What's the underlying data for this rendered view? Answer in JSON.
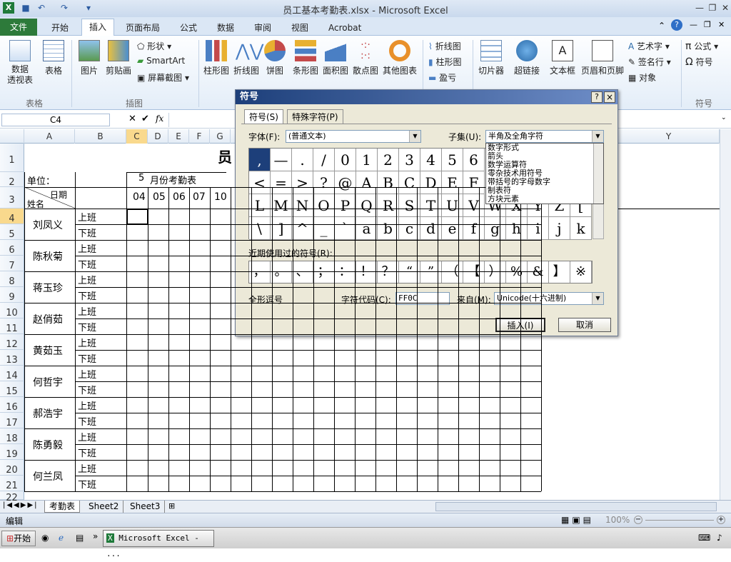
{
  "window": {
    "title": "员工基本考勤表.xlsx  -  Microsoft Excel"
  },
  "tabs": [
    "文件",
    "开始",
    "插入",
    "页面布局",
    "公式",
    "数据",
    "审阅",
    "视图",
    "Acrobat"
  ],
  "ribbon": {
    "pivot": "数据\n透视表",
    "table": "表格",
    "picture": "图片",
    "clipart": "剪贴画",
    "shapes": "形状",
    "smartart": "SmartArt",
    "screenshot": "屏幕截图",
    "column": "柱形图",
    "line": "折线图",
    "pie": "饼图",
    "bar": "条形图",
    "area": "面积图",
    "scatter": "散点图",
    "other": "其他图表",
    "spark_line": "折线图",
    "spark_col": "柱形图",
    "spark_wl": "盈亏",
    "slicer": "切片器",
    "hyperlink": "超链接",
    "textbox": "文本框",
    "headerfooter": "页眉和页脚",
    "wordart": "艺术字",
    "signature": "签名行",
    "object": "对象",
    "equation": "公式",
    "symbol": "符号",
    "grp_table": "表格",
    "grp_illus": "插图",
    "grp_symbol": "符号"
  },
  "namebox": "C4",
  "fx": "fx",
  "columns": [
    "A",
    "B",
    "C",
    "D",
    "E",
    "F",
    "G",
    "Y"
  ],
  "rows": [
    "1",
    "2",
    "3",
    "4",
    "5",
    "6",
    "7",
    "8",
    "9",
    "10",
    "11",
    "12",
    "13",
    "14",
    "15",
    "16",
    "17",
    "18",
    "19",
    "20",
    "21",
    "22"
  ],
  "sheet": {
    "title_char": "员",
    "unit": "单位：",
    "month_num": "5",
    "month_label": "月份考勤表",
    "date_label": "日期",
    "name_label": "姓名",
    "days": [
      "04",
      "05",
      "06",
      "07",
      "10"
    ],
    "employees": [
      "刘凤义",
      "陈秋菊",
      "蒋玉珍",
      "赵俏茹",
      "黄茹玉",
      "何哲宇",
      "郝浩宇",
      "陈勇毅",
      "何兰凤"
    ],
    "shift_on": "上班",
    "shift_off": "下班"
  },
  "sheet_tabs": [
    "考勤表",
    "Sheet2",
    "Sheet3"
  ],
  "status": {
    "mode": "编辑",
    "zoom": "100%"
  },
  "taskbar": {
    "start": "开始",
    "app": "Microsoft Excel - ..."
  },
  "dialog": {
    "title": "符号",
    "help": "?",
    "close": "×",
    "tab_symbols": "符号(S)",
    "tab_special": "特殊字符(P)",
    "font_label": "字体(F):",
    "font_value": "(普通文本)",
    "subset_label": "子集(U):",
    "subset_value": "半角及全角字符",
    "subset_list": [
      "数字形式",
      "箭头",
      "数学运算符",
      "零杂技术用符号",
      "带括号的字母数字",
      "制表符",
      "方块元素"
    ],
    "grid_rows": [
      [
        ",",
        "—",
        ".",
        "/",
        "0",
        "1",
        "2",
        "3",
        "4",
        "5",
        "6"
      ],
      [
        "<",
        "=",
        ">",
        "?",
        "@",
        "A",
        "B",
        "C",
        "D",
        "E",
        "F"
      ],
      [
        "L",
        "M",
        "N",
        "O",
        "P",
        "Q",
        "R",
        "S",
        "T",
        "U",
        "V",
        "W",
        "X",
        "Y",
        "Z",
        "["
      ],
      [
        "\\",
        "]",
        "^",
        "_",
        "`",
        "a",
        "b",
        "c",
        "d",
        "e",
        "f",
        "g",
        "h",
        "i",
        "j",
        "k"
      ]
    ],
    "recent_label": "近期使用过的符号(R):",
    "recent": [
      "，",
      "。",
      "、",
      "；",
      "：",
      "！",
      "？",
      "“",
      "”",
      "（",
      "【",
      "）",
      "%",
      "&",
      "】",
      "※"
    ],
    "char_name": "全形逗号",
    "code_label": "字符代码(C):",
    "code_value": "FF0C",
    "from_label": "来自(M):",
    "from_value": "Unicode(十六进制)",
    "insert": "插入(I)",
    "cancel": "取消"
  }
}
